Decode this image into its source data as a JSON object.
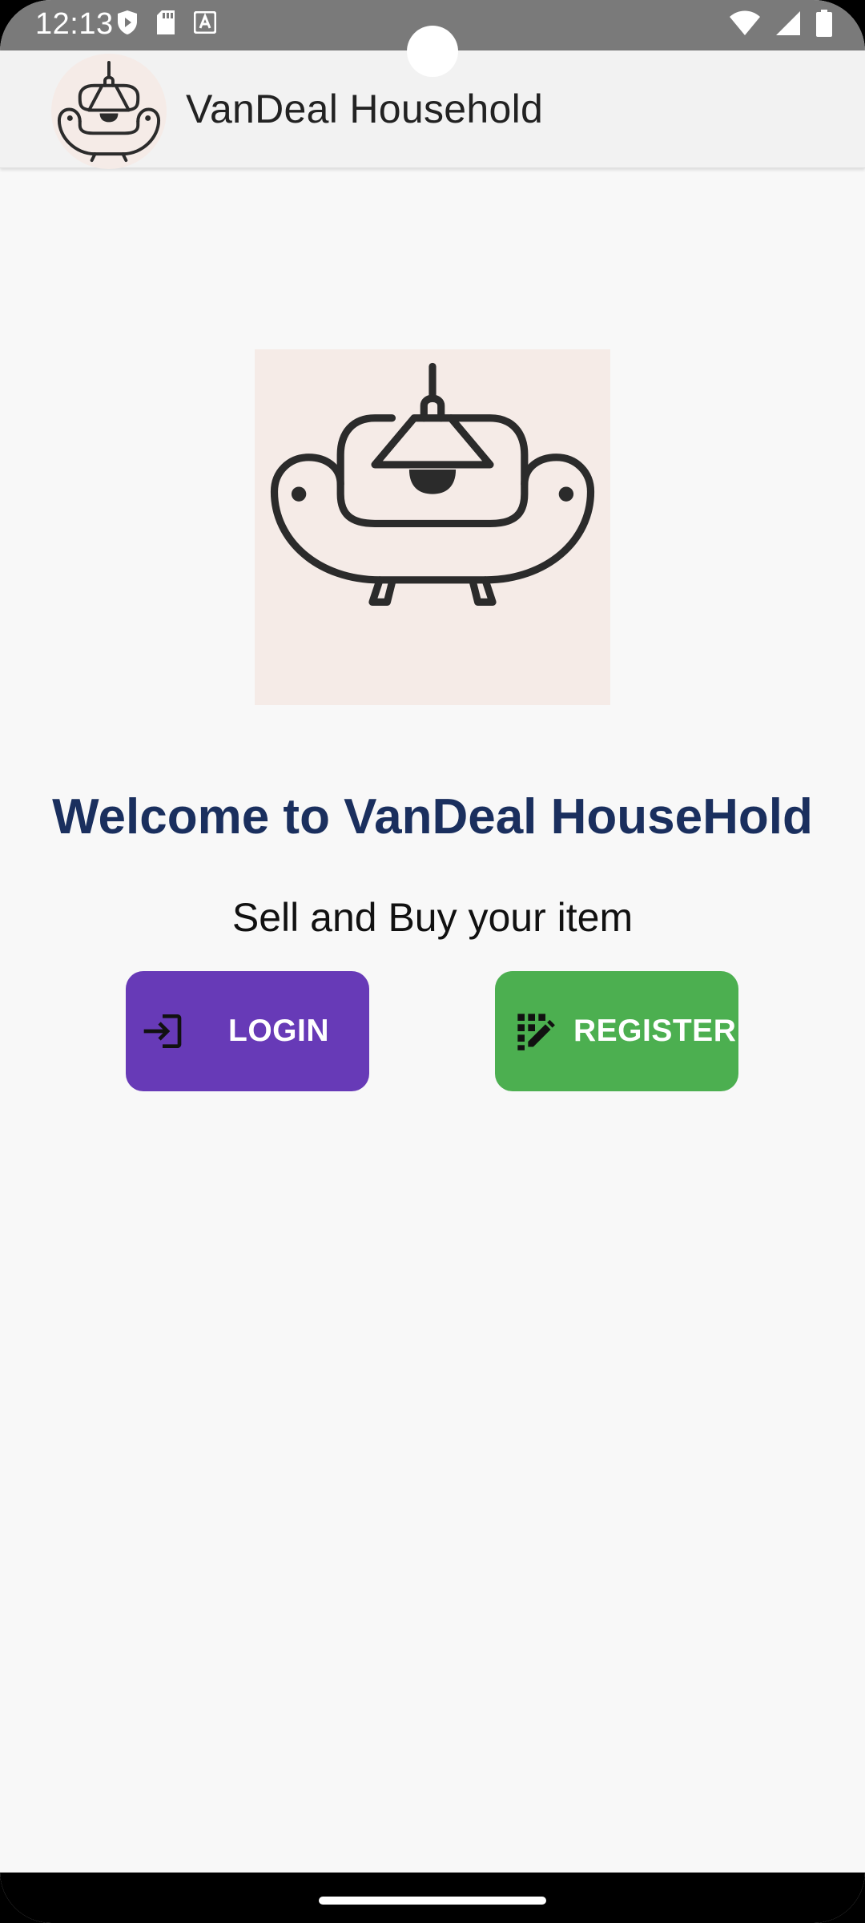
{
  "status_bar": {
    "time": "12:13",
    "left_icons": [
      "shield-play-icon",
      "sd-card-icon",
      "font-a-icon"
    ],
    "right_icons": [
      "wifi-icon",
      "signal-icon",
      "battery-icon"
    ]
  },
  "app_bar": {
    "title": "VanDeal Household",
    "logo_icon": "armchair-lamp-logo"
  },
  "main": {
    "hero_icon": "armchair-lamp-logo",
    "welcome_title": "Welcome to VanDeal HouseHold",
    "subtitle": "Sell and Buy your item",
    "login_button": {
      "label": "LOGIN",
      "icon": "login-icon",
      "color": "#673ab7"
    },
    "register_button": {
      "label": "REGISTER",
      "icon": "register-icon",
      "color": "#4caf50"
    }
  },
  "colors": {
    "title_color": "#1a2f5e",
    "logo_background": "#f5ebe7"
  }
}
